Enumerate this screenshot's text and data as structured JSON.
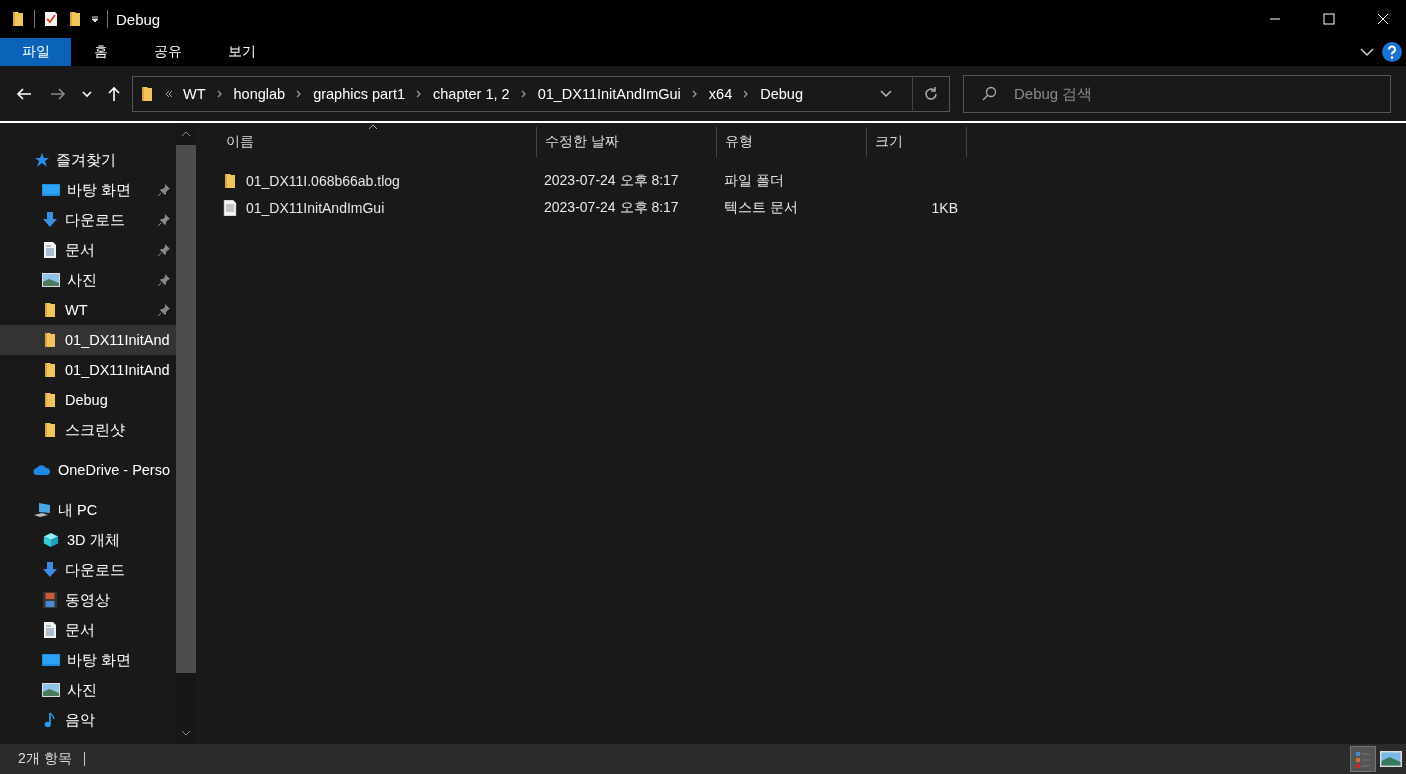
{
  "window": {
    "title": "Debug"
  },
  "ribbon_tabs": [
    {
      "label": "파일",
      "selected": true
    },
    {
      "label": "홈",
      "selected": false
    },
    {
      "label": "공유",
      "selected": false
    },
    {
      "label": "보기",
      "selected": false
    }
  ],
  "address_bar": {
    "path": [
      "WT",
      "honglab",
      "graphics part1",
      "chapter 1, 2",
      "01_DX11InitAndImGui",
      "x64",
      "Debug"
    ]
  },
  "search": {
    "placeholder": "Debug 검색"
  },
  "sidebar": {
    "items": [
      {
        "label": "즐겨찾기",
        "kind": "star",
        "selected": false,
        "children": [
          {
            "label": "바탕 화면",
            "kind": "desktop",
            "pinned": true,
            "selected": false
          },
          {
            "label": "다운로드",
            "kind": "download",
            "pinned": true,
            "selected": false
          },
          {
            "label": "문서",
            "kind": "document",
            "pinned": true,
            "selected": false
          },
          {
            "label": "사진",
            "kind": "picture",
            "pinned": true,
            "selected": false
          },
          {
            "label": "WT",
            "kind": "folder",
            "pinned": true,
            "selected": false
          },
          {
            "label": "01_DX11InitAnd",
            "kind": "folder",
            "pinned": false,
            "selected": true
          },
          {
            "label": "01_DX11InitAnd",
            "kind": "folder",
            "pinned": false,
            "selected": false
          },
          {
            "label": "Debug",
            "kind": "folder",
            "pinned": false,
            "selected": false
          },
          {
            "label": "스크린샷",
            "kind": "folder",
            "pinned": false,
            "selected": false
          }
        ]
      },
      {
        "label": "OneDrive - Perso",
        "kind": "cloud",
        "selected": false
      },
      {
        "label": "내 PC",
        "kind": "pc",
        "selected": false,
        "children": [
          {
            "label": "3D 개체",
            "kind": "cube",
            "pinned": false,
            "selected": false
          },
          {
            "label": "다운로드",
            "kind": "download",
            "pinned": false,
            "selected": false
          },
          {
            "label": "동영상",
            "kind": "film",
            "pinned": false,
            "selected": false
          },
          {
            "label": "문서",
            "kind": "document",
            "pinned": false,
            "selected": false
          },
          {
            "label": "바탕 화면",
            "kind": "desktop",
            "pinned": false,
            "selected": false
          },
          {
            "label": "사진",
            "kind": "picture",
            "pinned": false,
            "selected": false
          },
          {
            "label": "음악",
            "kind": "music",
            "pinned": false,
            "selected": false
          }
        ]
      }
    ]
  },
  "table": {
    "columns": [
      {
        "label": "이름",
        "sorted": true
      },
      {
        "label": "수정한 날짜",
        "sorted": false
      },
      {
        "label": "유형",
        "sorted": false
      },
      {
        "label": "크기",
        "sorted": false
      }
    ],
    "rows": [
      {
        "kind": "folder",
        "name": "01_DX11I.068b66ab.tlog",
        "modified": "2023-07-24 오후 8:17",
        "type": "파일 폴더"
      },
      {
        "kind": "text",
        "name": "01_DX11InitAndImGui",
        "modified": "2023-07-24 오후 8:17",
        "type": "텍스트 문서",
        "size": "1KB"
      }
    ]
  },
  "status_bar": {
    "item_count": "2개 항목",
    "views": [
      {
        "kind": "details",
        "selected": true
      },
      {
        "kind": "thumbnails",
        "selected": false
      }
    ]
  }
}
